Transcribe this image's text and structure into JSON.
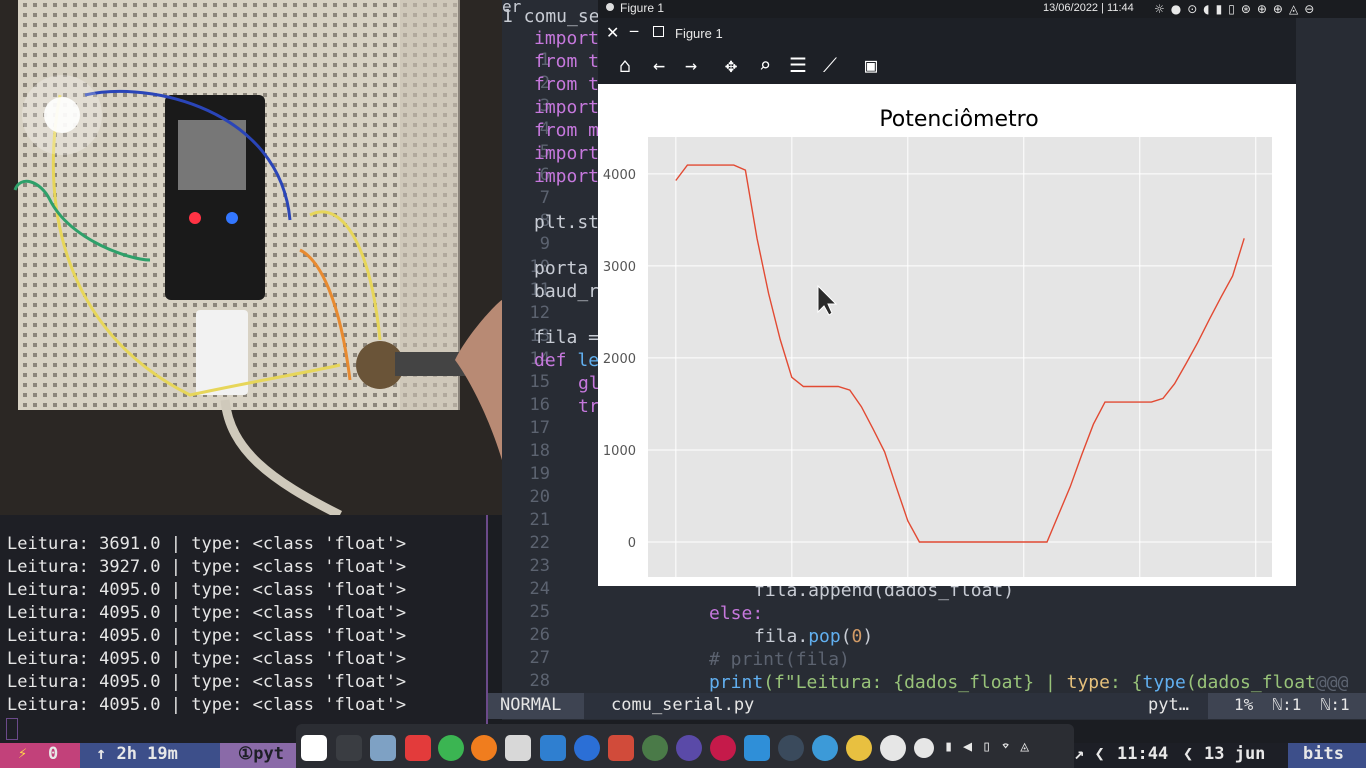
{
  "top_panel": {
    "window_label": "Figure 1",
    "datetime": "13/06/2022 | 11:44"
  },
  "terminal": {
    "lines": [
      "Leitura: 3691.0 | type: <class 'float'>",
      "Leitura: 3927.0 | type: <class 'float'>",
      "Leitura: 4095.0 | type: <class 'float'>",
      "Leitura: 4095.0 | type: <class 'float'>",
      "Leitura: 4095.0 | type: <class 'float'>",
      "Leitura: 4095.0 | type: <class 'float'>",
      "Leitura: 4095.0 | type: <class 'float'>",
      "Leitura: 4095.0 | type: <class 'float'>"
    ]
  },
  "editor": {
    "tab_partial": "er",
    "file_header_prefix": "1 comu_se",
    "line_numbers": [
      "1",
      "2",
      "3",
      "4",
      "5",
      "6",
      "7",
      "8",
      "9",
      "10",
      "11",
      "12",
      "13",
      "14",
      "15",
      "16",
      "17",
      "18",
      "19",
      "20",
      "21",
      "22",
      "23",
      "24",
      "25",
      "26",
      "27",
      "28"
    ],
    "code": {
      "l0": "import",
      "l1": "from t",
      "l2": "from t",
      "l3": "import",
      "l4": "from m",
      "l5": "import",
      "l6": "import",
      "l8": "plt.st",
      "l10": "porta",
      "l11": "baud_r",
      "l13": "fila =",
      "l14_kw": "def",
      "l14_rest": " le",
      "l15": "gl",
      "l16": "tr",
      "l24": "fila.append(dados_float)",
      "l25": "else:",
      "l26a": "fila.",
      "l26b": "pop",
      "l26c": "(",
      "l26d": "0",
      "l26e": ")",
      "l27": "# print(fila)",
      "l28a": "print",
      "l28b": "(f\"Leitura: {dados_float} | ",
      "l28c": "type",
      "l28d": ": {",
      "l28e": "type",
      "l28f": "(dados_float",
      "l28g": "@@@"
    }
  },
  "vim_status": {
    "mode": "NORMAL",
    "filename": "comu_serial.py",
    "filetype": "pyt…",
    "position": "1%  ℕ:1  ℕ:1"
  },
  "figure": {
    "title_bar": "Figure 1",
    "toolbar": [
      "home-icon",
      "back-icon",
      "forward-icon",
      "pan-icon",
      "zoom-icon",
      "configure-icon",
      "edit-axis-icon",
      "save-icon"
    ]
  },
  "chart_data": {
    "type": "line",
    "title": "Potenciômetro",
    "xlabel": "",
    "ylabel": "",
    "xlim": [
      -2.4,
      51.4
    ],
    "ylim": [
      -380,
      4400
    ],
    "xticks": [
      0,
      10,
      20,
      30,
      40,
      50
    ],
    "yticks": [
      0,
      1000,
      2000,
      3000,
      4000
    ],
    "grid": true,
    "line_color": "#e24a33",
    "series": [
      {
        "x": [
          0,
          1,
          2,
          3,
          4,
          5,
          6,
          7,
          8,
          9,
          10,
          11,
          12,
          13,
          14,
          15,
          16,
          17,
          18,
          19,
          20,
          21,
          22,
          23,
          24,
          25,
          26,
          27,
          28,
          29,
          30,
          31,
          32,
          33,
          34,
          35,
          36,
          37,
          38,
          39,
          40,
          41,
          42,
          43,
          44,
          45,
          46,
          47,
          48,
          49
        ],
        "values": [
          3927,
          4095,
          4095,
          4095,
          4095,
          4095,
          4040,
          3300,
          2700,
          2200,
          1790,
          1690,
          1690,
          1690,
          1690,
          1650,
          1470,
          1230,
          980,
          600,
          230,
          0,
          0,
          0,
          0,
          0,
          0,
          0,
          0,
          0,
          0,
          0,
          0,
          300,
          600,
          950,
          1280,
          1520,
          1520,
          1520,
          1520,
          1520,
          1560,
          1720,
          1940,
          2170,
          2420,
          2660,
          2890,
          3300
        ]
      }
    ]
  },
  "taskbar": {
    "left_counter": "0",
    "uptime": "↑ 2h 19m",
    "workspace": "①pyt",
    "clock": "11:44",
    "date": "13 jun",
    "session": "bits"
  }
}
